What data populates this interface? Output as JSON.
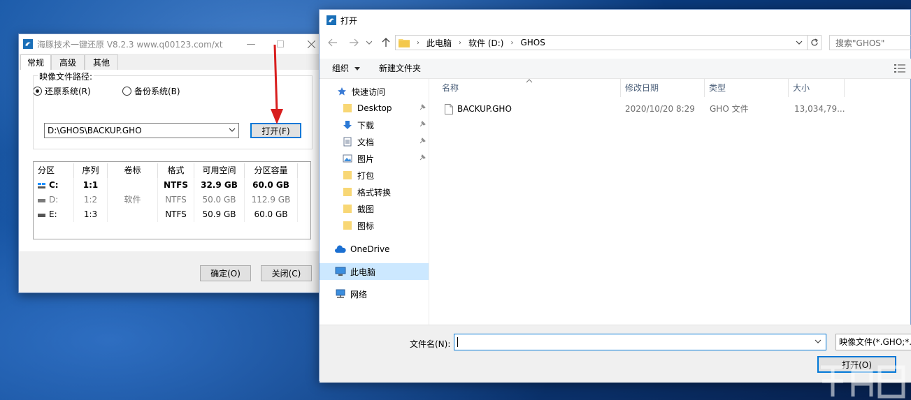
{
  "tool_window": {
    "title": "海豚技术一键还原 V8.2.3 www.q00123.com/xt",
    "tabs": [
      "常规",
      "高级",
      "其他"
    ],
    "radio_restore": "还原系统(R)",
    "radio_backup": "备份系统(B)",
    "image_path_label": "映像文件路径:",
    "image_path_value": "D:\\GHOS\\BACKUP.GHO",
    "open_button": "打开(F)",
    "table": {
      "headers": [
        "分区",
        "序列",
        "卷标",
        "格式",
        "可用空间",
        "分区容量"
      ],
      "rows": [
        {
          "drive": "C:",
          "seq": "1:1",
          "label": "",
          "fs": "NTFS",
          "free": "32.9 GB",
          "size": "60.0 GB"
        },
        {
          "drive": "D:",
          "seq": "1:2",
          "label": "软件",
          "fs": "NTFS",
          "free": "50.0 GB",
          "size": "112.9 GB"
        },
        {
          "drive": "E:",
          "seq": "1:3",
          "label": "",
          "fs": "NTFS",
          "free": "50.9 GB",
          "size": "60.0 GB"
        }
      ]
    },
    "ok_button": "确定(O)",
    "close_button": "关闭(C)"
  },
  "open_dialog": {
    "title": "打开",
    "breadcrumb": [
      "此电脑",
      "软件 (D:)",
      "GHOS"
    ],
    "search_placeholder": "搜索\"GHOS\"",
    "toolbar": {
      "organize": "组织",
      "new_folder": "新建文件夹"
    },
    "nav": {
      "quick_access": "快速访问",
      "items": [
        "Desktop",
        "下载",
        "文档",
        "图片",
        "打包",
        "格式转换",
        "截图",
        "图标"
      ],
      "onedrive": "OneDrive",
      "this_pc": "此电脑",
      "network": "网络"
    },
    "columns": [
      "名称",
      "修改日期",
      "类型",
      "大小"
    ],
    "files": [
      {
        "name": "BACKUP.GHO",
        "modified": "2020/10/20 8:29",
        "type": "GHO 文件",
        "size": "13,034,79..."
      }
    ],
    "filename_label": "文件名(N):",
    "filetype": "映像文件(*.GHO;*.V",
    "open_button": "打开(O)"
  },
  "colors": {
    "accent": "#0078d7",
    "arrow": "#d81e1e",
    "folder": "#f8d775",
    "selected": "#cce8ff"
  }
}
